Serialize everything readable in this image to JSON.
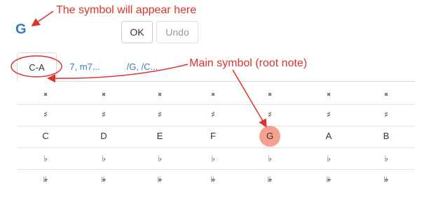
{
  "symbol": "G",
  "buttons": {
    "ok": "OK",
    "undo": "Undo"
  },
  "tabs": [
    {
      "label": "C-A",
      "active": true
    },
    {
      "label": "7, m7...",
      "active": false
    },
    {
      "label": "/G, /C...",
      "active": false
    }
  ],
  "grid": {
    "columns": [
      "C",
      "D",
      "E",
      "F",
      "G",
      "A",
      "B"
    ],
    "selected_note": "G",
    "rows": [
      {
        "name": "double-sharp",
        "glyph": "𝄪"
      },
      {
        "name": "sharp",
        "glyph": "♯"
      },
      {
        "name": "natural",
        "glyph": ""
      },
      {
        "name": "flat",
        "glyph": "♭"
      },
      {
        "name": "double-flat",
        "glyph": "𝄫"
      }
    ]
  },
  "annotations": {
    "symbol_note": "The symbol will appear here",
    "main_symbol_note": "Main symbol (root note)",
    "color": "#e0312b"
  },
  "colors": {
    "accent": "#3a7bbf",
    "selected": "#f6a08f"
  }
}
